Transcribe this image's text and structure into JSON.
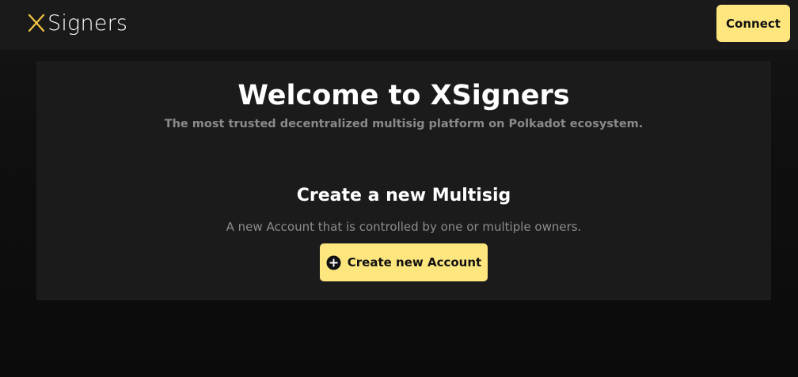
{
  "header": {
    "logo_text": "Signers",
    "connect_label": "Connect"
  },
  "hero": {
    "title": "Welcome to XSigners",
    "subtitle": "The most trusted decentralized multisig platform on Polkadot ecosystem."
  },
  "create_section": {
    "title": "Create a new Multisig",
    "description": "A new Account that is controlled by one or multiple owners.",
    "button_label": "Create new Account",
    "button_icon": "plus-circle-icon"
  },
  "colors": {
    "accent": "#fde67e",
    "logo_mark": "#f5c542",
    "header_bg": "#1a1a1a",
    "card_bg": "#1b1b1b"
  }
}
